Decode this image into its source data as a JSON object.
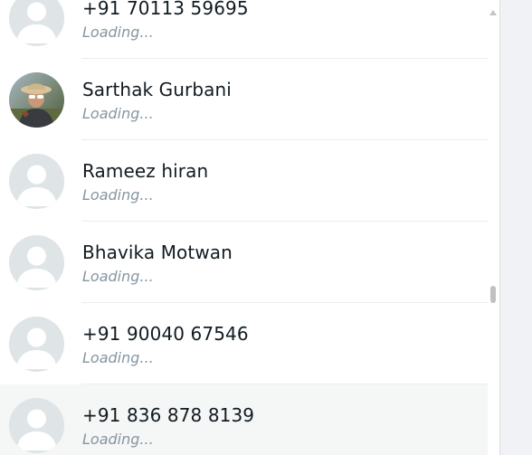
{
  "contacts": [
    {
      "name": "+91 70113 59695",
      "status": "Loading...",
      "avatar": "default-avatar"
    },
    {
      "name": "Sarthak Gurbani",
      "status": "Loading...",
      "avatar": "photo"
    },
    {
      "name": "Rameez hiran",
      "status": "Loading...",
      "avatar": "default-avatar"
    },
    {
      "name": "Bhavika Motwan",
      "status": "Loading...",
      "avatar": "default-avatar"
    },
    {
      "name": "+91 90040 67546",
      "status": "Loading...",
      "avatar": "default-avatar"
    },
    {
      "name": "+91 836 878 8139",
      "status": "Loading...",
      "avatar": "default-avatar"
    }
  ],
  "colors": {
    "name_text": "#111b21",
    "status_text": "#8696a0",
    "avatar_bg": "#dfe5e7",
    "hover_row": "#f5f6f6",
    "divider": "#e9edef"
  }
}
